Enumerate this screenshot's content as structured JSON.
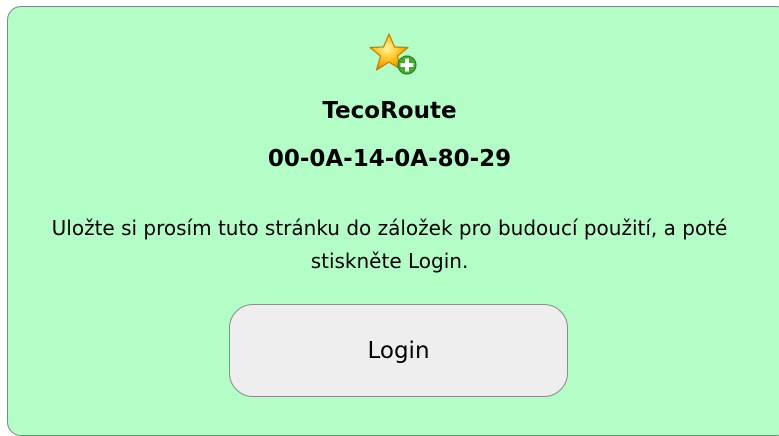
{
  "header": {
    "icon": "star-add-icon",
    "title": "TecoRoute",
    "device_id": "00-0A-14-0A-80-29"
  },
  "message": "Uložte si prosím tuto stránku do záložek pro budoucí použití, a poté stiskněte Login.",
  "login_button": {
    "label": "Login"
  },
  "colors": {
    "panel_background": "#b3fdc6",
    "button_background": "#eeeeee"
  }
}
